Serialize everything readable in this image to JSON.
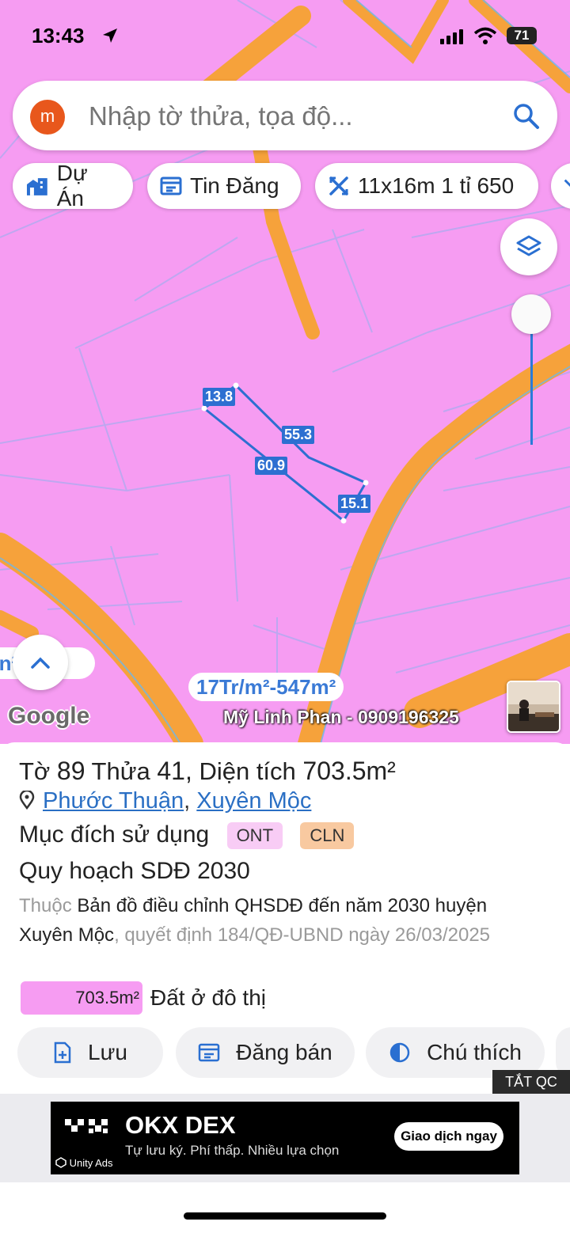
{
  "status_bar": {
    "time": "13:43",
    "battery": "71"
  },
  "search": {
    "avatar_letter": "m",
    "placeholder": "Nhập tờ thửa, tọa độ..."
  },
  "chips": [
    {
      "label": "Dự Án",
      "icon": "building-icon"
    },
    {
      "label": "Tin Đăng",
      "icon": "listing-icon"
    },
    {
      "label": "11x16m 1 tỉ 650",
      "icon": "ruler-icon"
    }
  ],
  "plot_edges": [
    "13.8",
    "55.3",
    "60.9",
    "15.1"
  ],
  "map_overlay": {
    "area_left": "-n²",
    "price_pill": "17Tr/m²-547m²",
    "google_logo": "Google",
    "watermark": "Mỹ Linh Phan - 0909196325"
  },
  "parcel": {
    "sheet_label": "Tờ",
    "sheet_no": "89",
    "plot_label": "Thửa",
    "plot_no": "41,",
    "area_label": "Diện tích",
    "area": "703.5m²",
    "ward": "Phước Thuận",
    "district": "Xuyên Mộc",
    "purpose_label": "Mục đích sử dụng",
    "purpose_tags": [
      "ONT",
      "CLN"
    ],
    "plan_title": "Quy hoạch SDĐ 2030",
    "desc_prefix": "Thuộc",
    "desc_map": "Bản đồ điều chỉnh QHSDĐ đến năm 2030 huyện Xuyên Mộc",
    "desc_decision": ", quyết định 184/QĐ-UBND ngày 26/03/2025",
    "legend_area": "703.5m²",
    "legend_text": "Đất ở đô thị"
  },
  "colors": {
    "residential": "#f69cf2",
    "road": "#f6a23b",
    "link": "#2a6fc4",
    "ont_tag": "#f8ccf5",
    "cln_tag": "#f8c9a0"
  },
  "actions": [
    "Lưu",
    "Đăng bán",
    "Chú thích"
  ],
  "ad": {
    "close_label": "TẮT QC",
    "title": "OKX DEX",
    "subtitle": "Tự lưu ký. Phí thấp. Nhiều lựa chọn",
    "cta": "Giao dịch ngay",
    "network": "Unity Ads"
  }
}
